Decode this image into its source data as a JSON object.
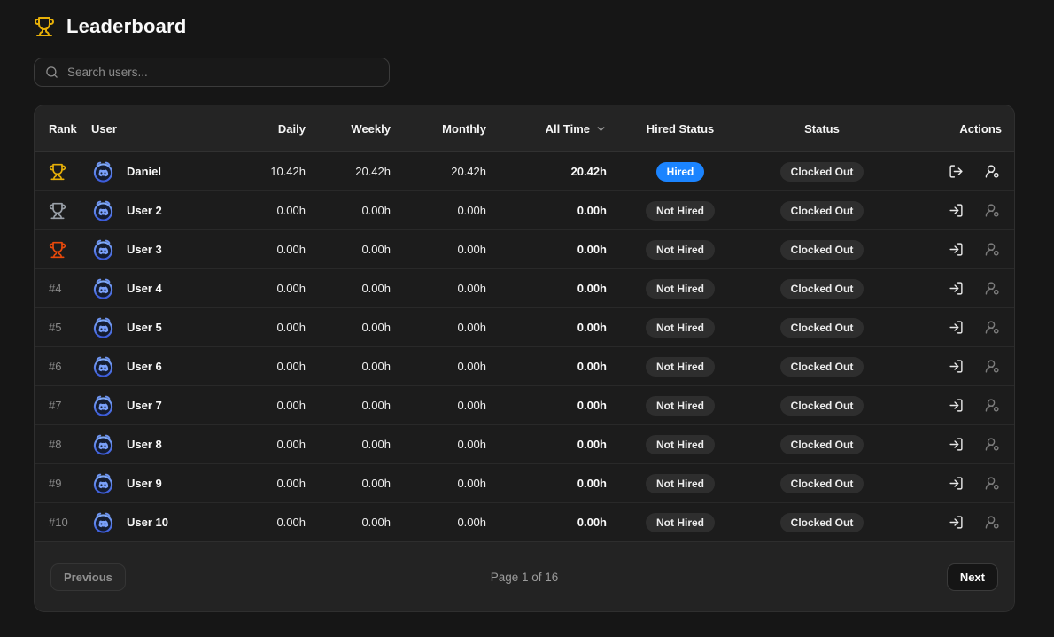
{
  "page": {
    "title": "Leaderboard"
  },
  "icons": {
    "title": "trophy-icon",
    "search": "search-icon",
    "sort": "chevron-down-icon",
    "clock_out": "log-out-icon",
    "clock_in": "log-in-icon",
    "user_manage": "user-settings-icon",
    "avatar": "discord-clock-avatar"
  },
  "colors": {
    "page_bg": "#161616",
    "card_bg": "#222222",
    "row_bg": "#1c1c1c",
    "hired_badge": "#1b84ff",
    "neutral_badge": "#2e2e2e",
    "trophy_gold": "#e7b008",
    "trophy_silver": "#9aa0a8",
    "trophy_bronze": "#e8490b"
  },
  "search": {
    "placeholder": "Search users..."
  },
  "table": {
    "columns": {
      "rank": "Rank",
      "user": "User",
      "daily": "Daily",
      "weekly": "Weekly",
      "monthly": "Monthly",
      "all_time": "All Time",
      "hired": "Hired Status",
      "status": "Status",
      "actions": "Actions"
    },
    "rows": [
      {
        "rank": {
          "type": "trophy",
          "tier": "gold"
        },
        "name": "Daniel",
        "daily": "10.42h",
        "weekly": "20.42h",
        "monthly": "20.42h",
        "all_time": "20.42h",
        "hired_status": "Hired",
        "status": "Clocked Out",
        "clock_action": "log-out",
        "user_action_dim": false
      },
      {
        "rank": {
          "type": "trophy",
          "tier": "silver"
        },
        "name": "User 2",
        "daily": "0.00h",
        "weekly": "0.00h",
        "monthly": "0.00h",
        "all_time": "0.00h",
        "hired_status": "Not Hired",
        "status": "Clocked Out",
        "clock_action": "log-in",
        "user_action_dim": true
      },
      {
        "rank": {
          "type": "trophy",
          "tier": "bronze"
        },
        "name": "User 3",
        "daily": "0.00h",
        "weekly": "0.00h",
        "monthly": "0.00h",
        "all_time": "0.00h",
        "hired_status": "Not Hired",
        "status": "Clocked Out",
        "clock_action": "log-in",
        "user_action_dim": true
      },
      {
        "rank": {
          "type": "number",
          "label": "#4"
        },
        "name": "User 4",
        "daily": "0.00h",
        "weekly": "0.00h",
        "monthly": "0.00h",
        "all_time": "0.00h",
        "hired_status": "Not Hired",
        "status": "Clocked Out",
        "clock_action": "log-in",
        "user_action_dim": true
      },
      {
        "rank": {
          "type": "number",
          "label": "#5"
        },
        "name": "User 5",
        "daily": "0.00h",
        "weekly": "0.00h",
        "monthly": "0.00h",
        "all_time": "0.00h",
        "hired_status": "Not Hired",
        "status": "Clocked Out",
        "clock_action": "log-in",
        "user_action_dim": true
      },
      {
        "rank": {
          "type": "number",
          "label": "#6"
        },
        "name": "User 6",
        "daily": "0.00h",
        "weekly": "0.00h",
        "monthly": "0.00h",
        "all_time": "0.00h",
        "hired_status": "Not Hired",
        "status": "Clocked Out",
        "clock_action": "log-in",
        "user_action_dim": true
      },
      {
        "rank": {
          "type": "number",
          "label": "#7"
        },
        "name": "User 7",
        "daily": "0.00h",
        "weekly": "0.00h",
        "monthly": "0.00h",
        "all_time": "0.00h",
        "hired_status": "Not Hired",
        "status": "Clocked Out",
        "clock_action": "log-in",
        "user_action_dim": true
      },
      {
        "rank": {
          "type": "number",
          "label": "#8"
        },
        "name": "User 8",
        "daily": "0.00h",
        "weekly": "0.00h",
        "monthly": "0.00h",
        "all_time": "0.00h",
        "hired_status": "Not Hired",
        "status": "Clocked Out",
        "clock_action": "log-in",
        "user_action_dim": true
      },
      {
        "rank": {
          "type": "number",
          "label": "#9"
        },
        "name": "User 9",
        "daily": "0.00h",
        "weekly": "0.00h",
        "monthly": "0.00h",
        "all_time": "0.00h",
        "hired_status": "Not Hired",
        "status": "Clocked Out",
        "clock_action": "log-in",
        "user_action_dim": true
      },
      {
        "rank": {
          "type": "number",
          "label": "#10"
        },
        "name": "User 10",
        "daily": "0.00h",
        "weekly": "0.00h",
        "monthly": "0.00h",
        "all_time": "0.00h",
        "hired_status": "Not Hired",
        "status": "Clocked Out",
        "clock_action": "log-in",
        "user_action_dim": true
      }
    ]
  },
  "pagination": {
    "previous_label": "Previous",
    "page_info": "Page 1 of 16",
    "next_label": "Next"
  }
}
